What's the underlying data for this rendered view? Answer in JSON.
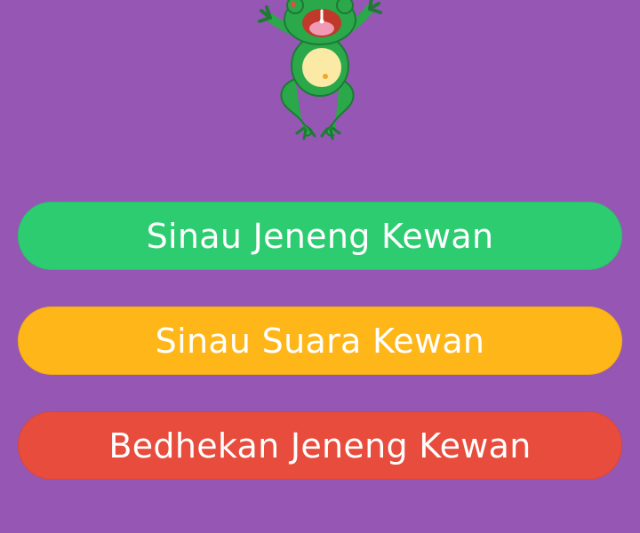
{
  "mascot": {
    "icon": "frog-icon"
  },
  "colors": {
    "background": "#9556b4",
    "menu_button_1": "#2ecc71",
    "menu_button_2": "#ffb618",
    "menu_button_3": "#e74c3c"
  },
  "menu": {
    "items": [
      {
        "label": "Sinau Jeneng Kewan"
      },
      {
        "label": "Sinau Suara Kewan"
      },
      {
        "label": "Bedhekan Jeneng Kewan"
      }
    ]
  }
}
